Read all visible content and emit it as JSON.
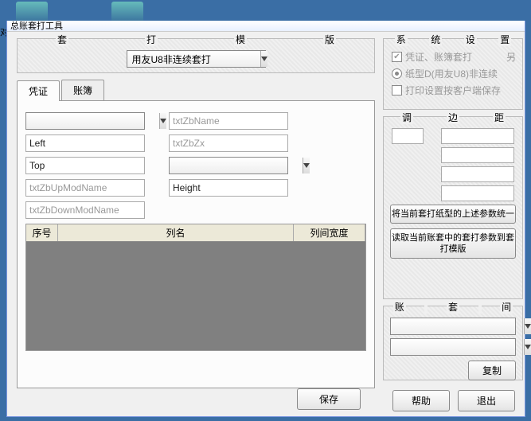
{
  "desktop_partial_label": "对",
  "window_title": "总账套打工具",
  "left_group": {
    "c1": "套",
    "c2": "打",
    "c3": "模",
    "c4": "版"
  },
  "mode_combo": "用友U8非连续套打",
  "tabs": {
    "voucher": "凭证",
    "book": "账簿"
  },
  "form": {
    "empty_combo": "",
    "left": "Left",
    "top": "Top",
    "upmod": "txtZbUpModName",
    "downmod": "txtZbDownModName",
    "zbname": "txtZbName",
    "zbzx": "txtZbZx",
    "right_combo": "",
    "height": "Height"
  },
  "grid": {
    "seq": "序号",
    "name": "列名",
    "width": "列间宽度"
  },
  "save_btn": "保存",
  "sys_group": {
    "c1": "系",
    "c2": "统",
    "c3": "设",
    "c4": "置"
  },
  "chk_label": "凭证、账簿套打",
  "chk_tail": "另",
  "radio_label": "纸型D(用友U8)非连续",
  "save_client": "打印设置按客户端保存",
  "adjust_group": {
    "c1": "调",
    "c2": "边",
    "c3": "距"
  },
  "long_btn1": "将当前套打纸型的上述参数统一",
  "long_btn2": "读取当前账套中的套打参数到套打模版",
  "copy_group": {
    "c1": "账",
    "c2": "套",
    "c3": "间"
  },
  "copy_btn": "复制",
  "help_btn": "帮助",
  "exit_btn": "退出"
}
